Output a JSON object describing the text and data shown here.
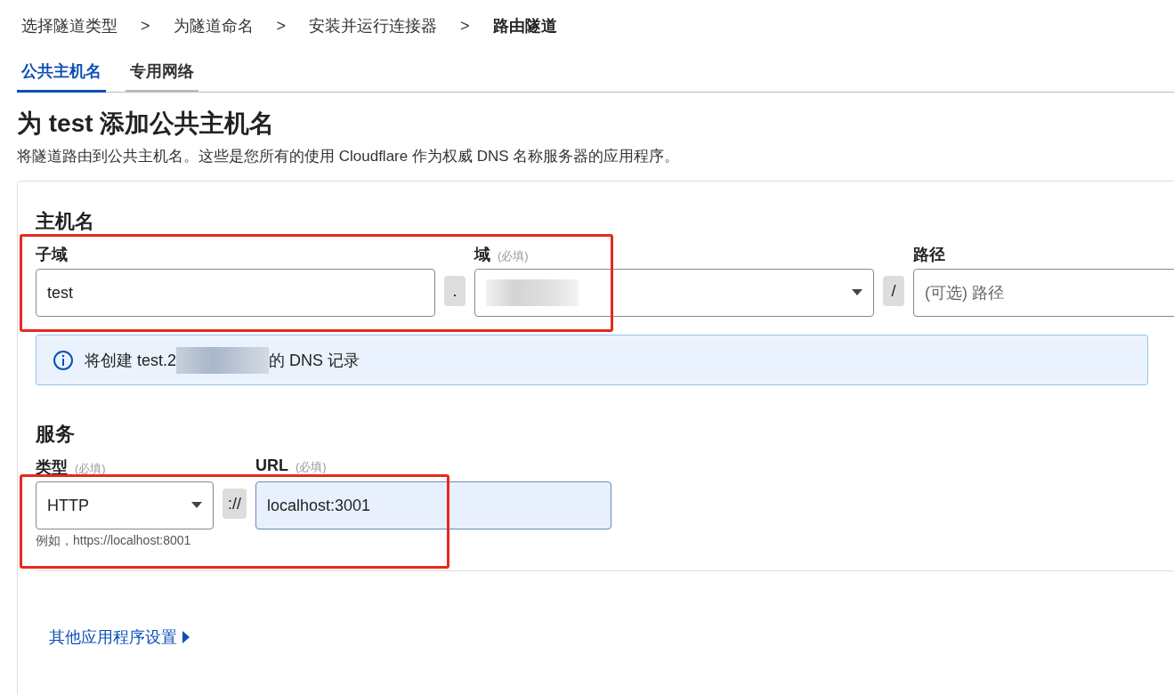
{
  "breadcrumb": [
    {
      "label": "选择隧道类型",
      "current": false
    },
    {
      "label": "为隧道命名",
      "current": false
    },
    {
      "label": "安装并运行连接器",
      "current": false
    },
    {
      "label": "路由隧道",
      "current": true
    }
  ],
  "breadcrumb_separator": ">",
  "tabs": [
    {
      "label": "公共主机名",
      "selected": true
    },
    {
      "label": "专用网络",
      "selected": false
    }
  ],
  "title": "为 test 添加公共主机名",
  "description": "将隧道路由到公共主机名。这些是您所有的使用 Cloudflare 作为权威 DNS 名称服务器的应用程序。",
  "hostname": {
    "heading": "主机名",
    "subdomain": {
      "label": "子域",
      "value": "test"
    },
    "dot": ".",
    "domain": {
      "label": "域",
      "required": "(必填)",
      "redacted": true
    },
    "slash": "/",
    "path": {
      "label": "路径",
      "placeholder": "(可选) 路径"
    },
    "notice": {
      "prefix": "将创建 test.2",
      "suffix": "的 DNS 记录"
    }
  },
  "service": {
    "heading": "服务",
    "type": {
      "label": "类型",
      "required": "(必填)",
      "value": "HTTP",
      "hint": "例如，https://localhost:8001"
    },
    "separator": "://",
    "url": {
      "label": "URL",
      "required": "(必填)",
      "value": "localhost:3001"
    }
  },
  "more_settings": "其他应用程序设置"
}
